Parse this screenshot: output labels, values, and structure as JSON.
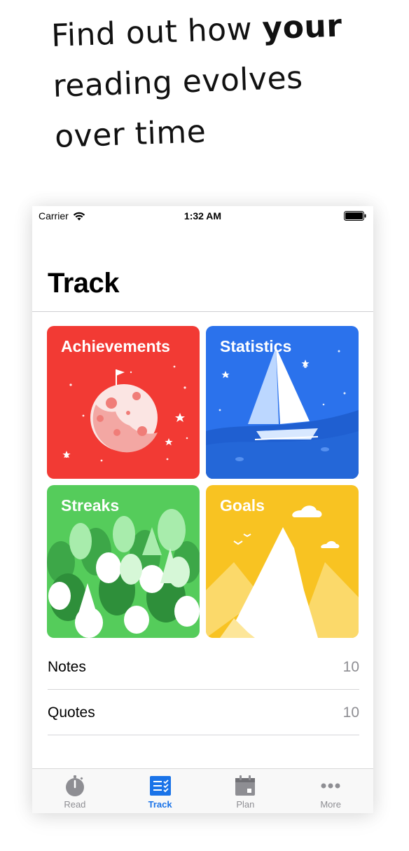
{
  "promo": {
    "line1_regular": "Find out how ",
    "line1_bold": "your",
    "line2": "reading evolves",
    "line3": "over time"
  },
  "status_bar": {
    "carrier": "Carrier",
    "time": "1:32 AM"
  },
  "nav": {
    "title": "Track"
  },
  "cards": [
    {
      "label": "Achievements",
      "color": "#f23a34",
      "icon": "moon-flag-illustration"
    },
    {
      "label": "Statistics",
      "color": "#2b72ec",
      "icon": "sailboat-illustration"
    },
    {
      "label": "Streaks",
      "color": "#55cc5b",
      "icon": "forest-illustration"
    },
    {
      "label": "Goals",
      "color": "#f8c322",
      "icon": "mountain-illustration"
    }
  ],
  "list": [
    {
      "label": "Notes",
      "count": "10"
    },
    {
      "label": "Quotes",
      "count": "10"
    }
  ],
  "tab_bar": {
    "tabs": [
      {
        "label": "Read",
        "icon": "stopwatch-icon"
      },
      {
        "label": "Track",
        "icon": "checklist-icon",
        "active": true
      },
      {
        "label": "Plan",
        "icon": "calendar-icon"
      },
      {
        "label": "More",
        "icon": "more-icon"
      }
    ],
    "active_color": "#1a73e8"
  }
}
